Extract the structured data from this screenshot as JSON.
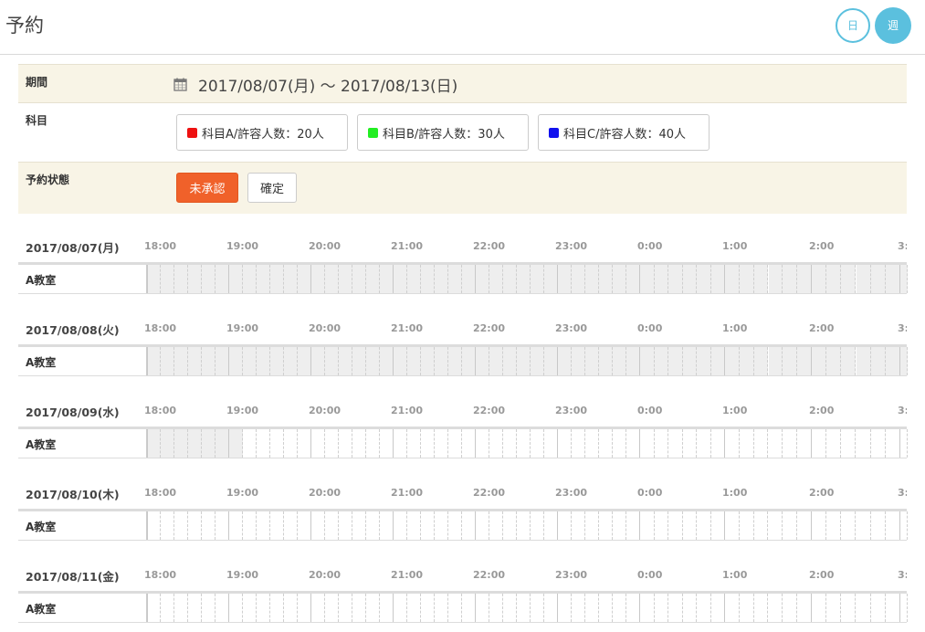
{
  "page_title": "予約",
  "view_toggle": {
    "day": "日",
    "week": "週"
  },
  "filters": {
    "period": {
      "label": "期間",
      "value": "2017/08/07(月) 〜 2017/08/13(日)"
    },
    "subject": {
      "label": "科目",
      "items": [
        {
          "text": "科目A/許容人数：20人",
          "color": "#ee1111"
        },
        {
          "text": "科目B/許容人数：30人",
          "color": "#22ee22"
        },
        {
          "text": "科目C/許容人数：40人",
          "color": "#1111ee"
        }
      ]
    },
    "status": {
      "label": "予約状態",
      "pending": "未承認",
      "confirmed": "確定"
    }
  },
  "schedule": {
    "hours": [
      "18:00",
      "19:00",
      "20:00",
      "21:00",
      "22:00",
      "23:00",
      "0:00",
      "1:00",
      "2:00",
      "3:"
    ],
    "room": "A教室",
    "days": [
      {
        "date": "2017/08/07(月)",
        "booked_fraction": 1.0
      },
      {
        "date": "2017/08/08(火)",
        "booked_fraction": 1.0
      },
      {
        "date": "2017/08/09(水)",
        "booked_fraction": 0.134
      },
      {
        "date": "2017/08/10(木)",
        "booked_fraction": 0.0
      },
      {
        "date": "2017/08/11(金)",
        "booked_fraction": 0.0
      }
    ]
  }
}
